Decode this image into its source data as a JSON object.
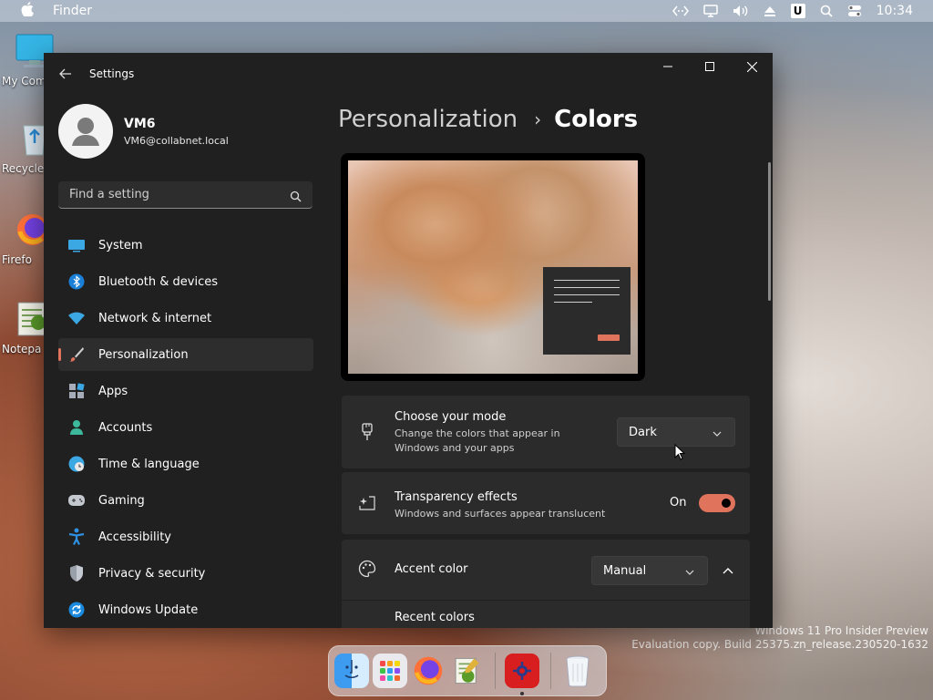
{
  "menubar": {
    "app_name": "Finder",
    "clock": "10:34",
    "u_badge": "U"
  },
  "desktop": {
    "icons": [
      {
        "label": "My Com",
        "icon": "monitor-icon"
      },
      {
        "label": "Recycle",
        "icon": "recycle-bin-icon"
      },
      {
        "label": "Firefo",
        "icon": "firefox-icon"
      },
      {
        "label": "Notepa",
        "icon": "notepad-icon"
      }
    ],
    "watermark_line1": "Windows 11 Pro Insider Preview",
    "watermark_line2": "Evaluation copy. Build 25375.zn_release.230520-1632"
  },
  "dock": {
    "items": [
      "finder-icon",
      "launchpad-icon",
      "firefox-icon",
      "notepad-icon",
      "settings-app-icon",
      "trash-icon"
    ]
  },
  "window": {
    "title": "Settings",
    "user": {
      "name": "VM6",
      "email": "VM6@collabnet.local"
    },
    "search": {
      "placeholder": "Find a setting"
    },
    "nav": [
      {
        "label": "System",
        "icon": "system-icon"
      },
      {
        "label": "Bluetooth & devices",
        "icon": "bluetooth-icon"
      },
      {
        "label": "Network & internet",
        "icon": "wifi-icon"
      },
      {
        "label": "Personalization",
        "icon": "brush-icon",
        "active": true
      },
      {
        "label": "Apps",
        "icon": "apps-icon"
      },
      {
        "label": "Accounts",
        "icon": "accounts-icon"
      },
      {
        "label": "Time & language",
        "icon": "globe-clock-icon"
      },
      {
        "label": "Gaming",
        "icon": "gamepad-icon"
      },
      {
        "label": "Accessibility",
        "icon": "accessibility-icon"
      },
      {
        "label": "Privacy & security",
        "icon": "shield-icon"
      },
      {
        "label": "Windows Update",
        "icon": "update-icon"
      }
    ],
    "breadcrumb": {
      "parent": "Personalization",
      "separator": "›",
      "current": "Colors"
    },
    "mode": {
      "title": "Choose your mode",
      "desc_line1": "Change the colors that appear in",
      "desc_line2": "Windows and your apps",
      "value": "Dark"
    },
    "transparency": {
      "title": "Transparency effects",
      "desc": "Windows and surfaces appear translucent",
      "state_label": "On",
      "enabled": true
    },
    "accent": {
      "title": "Accent color",
      "value": "Manual",
      "recent_label": "Recent colors"
    },
    "accent_color": "#e0735c"
  }
}
